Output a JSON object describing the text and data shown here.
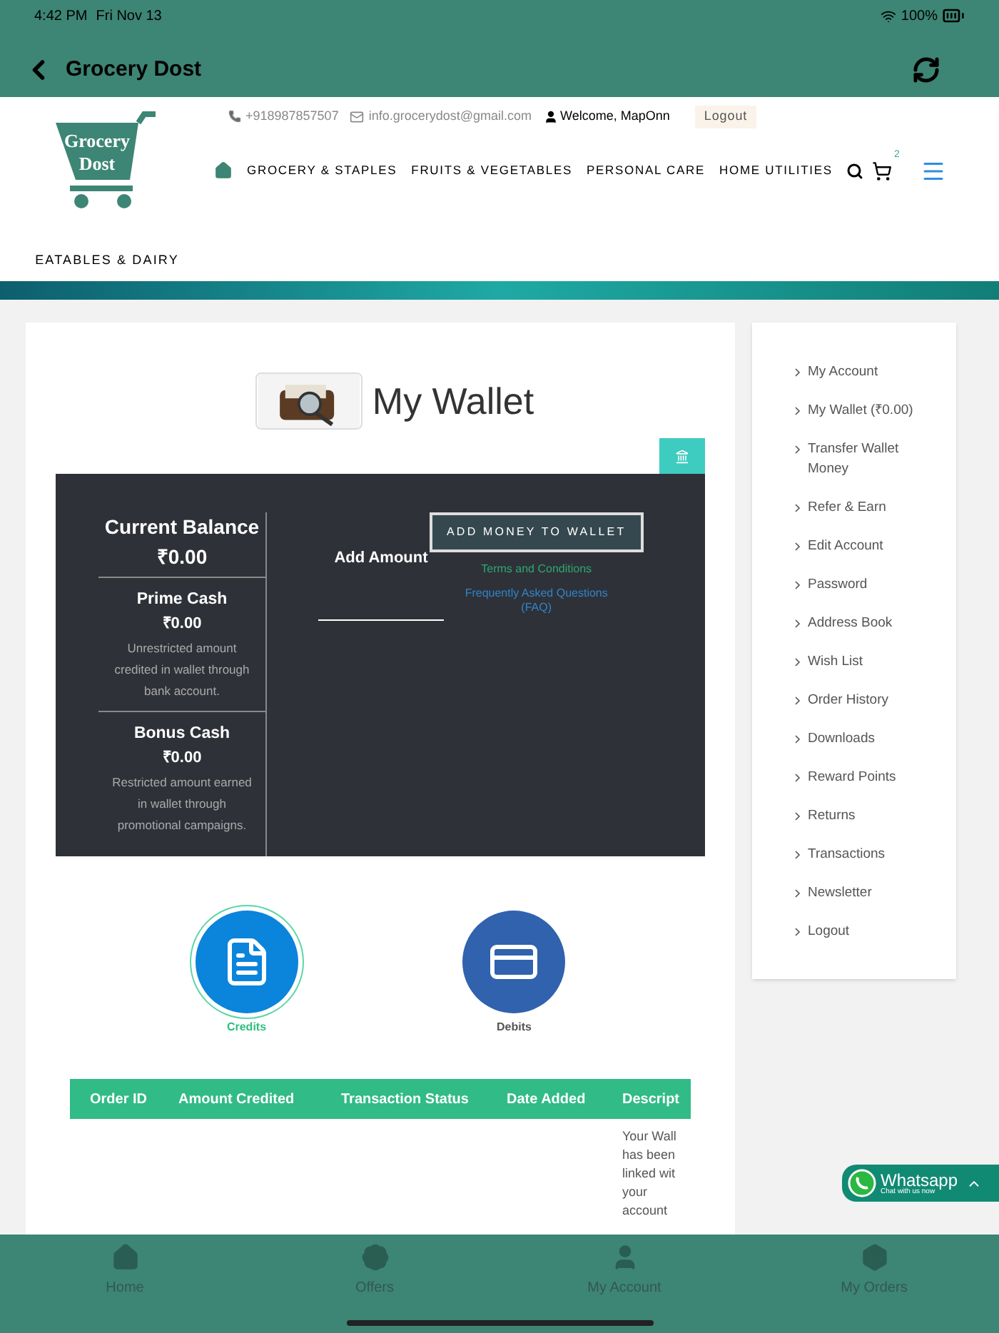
{
  "status_bar": {
    "time": "4:42 PM",
    "date": "Fri Nov 13",
    "battery": "100%"
  },
  "app_bar": {
    "title": "Grocery Dost"
  },
  "header": {
    "phone": "+918987857507",
    "email": "info.grocerydost@gmail.com",
    "welcome": "Welcome, MapOnn",
    "logout": "Logout",
    "logo_line1": "Grocery",
    "logo_line2": "Dost",
    "cart_count": "2",
    "nav": [
      "GROCERY & STAPLES",
      "FRUITS & VEGETABLES",
      "PERSONAL CARE",
      "HOME UTILITIES"
    ],
    "nav_extra": "EATABLES & DAIRY"
  },
  "wallet": {
    "title": "My Wallet",
    "current_balance_label": "Current Balance",
    "current_balance": "₹0.00",
    "sections": [
      {
        "title": "Prime Cash",
        "amount": "₹0.00",
        "note": "Unrestricted amount credited in wallet through bank account."
      },
      {
        "title": "Bonus Cash",
        "amount": "₹0.00",
        "note": "Restricted amount earned in wallet through promotional campaigns."
      }
    ],
    "add_amount_label": "Add Amount",
    "add_button": "ADD MONEY TO WALLET",
    "terms": "Terms and Conditions",
    "faq": "Frequently Asked Questions (FAQ)"
  },
  "tabs": [
    {
      "label": "Credits",
      "selected": true
    },
    {
      "label": "Debits",
      "selected": false
    }
  ],
  "table": {
    "columns": [
      "Order ID",
      "Amount Credited",
      "Transaction Status",
      "Date Added",
      "Descript"
    ],
    "rows": [
      [
        "",
        "",
        "",
        "",
        "Your Wall has been linked wit your account"
      ]
    ]
  },
  "sidebar": {
    "items": [
      "My Account",
      "My Wallet (₹0.00)",
      "Transfer Wallet Money",
      "Refer & Earn",
      "Edit Account",
      "Password",
      "Address Book",
      "Wish List",
      "Order History",
      "Downloads",
      "Reward Points",
      "Returns",
      "Transactions",
      "Newsletter",
      "Logout"
    ]
  },
  "whatsapp": {
    "title": "Whatsapp",
    "subtitle": "Chat with us now"
  },
  "bottom_nav": [
    {
      "label": "Home",
      "selected": false
    },
    {
      "label": "Offers",
      "selected": false
    },
    {
      "label": "My Account",
      "selected": false
    },
    {
      "label": "My Orders",
      "selected": false
    }
  ]
}
